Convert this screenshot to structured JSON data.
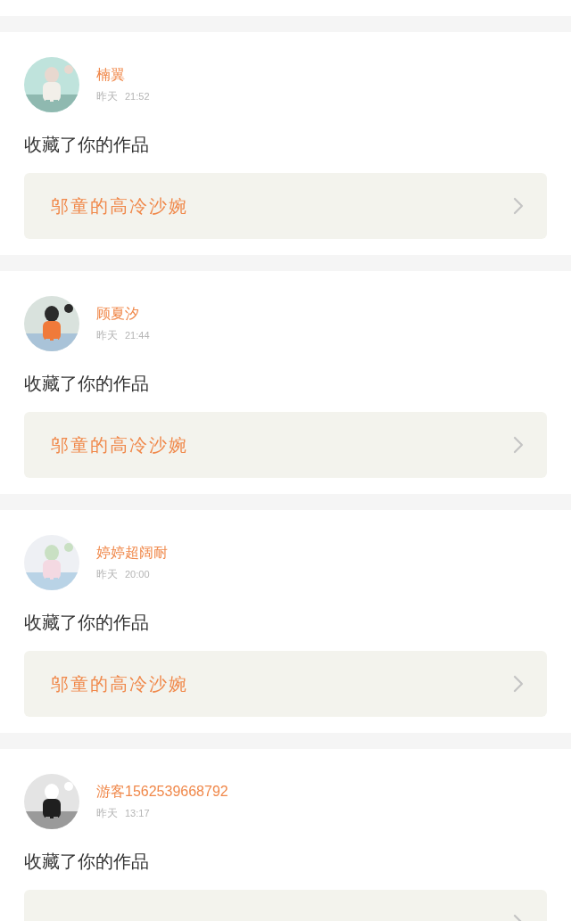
{
  "notifications": [
    {
      "user": "楠翼",
      "day": "昨天",
      "time": "21:52",
      "action": "收藏了你的作品",
      "work": "邬童的高冷沙婉"
    },
    {
      "user": "顾夏汐",
      "day": "昨天",
      "time": "21:44",
      "action": "收藏了你的作品",
      "work": "邬童的高冷沙婉"
    },
    {
      "user": "婷婷超阔耐",
      "day": "昨天",
      "time": "20:00",
      "action": "收藏了你的作品",
      "work": "邬童的高冷沙婉"
    },
    {
      "user": "游客1562539668792",
      "day": "昨天",
      "time": "13:17",
      "action": "收藏了你的作品"
    }
  ]
}
